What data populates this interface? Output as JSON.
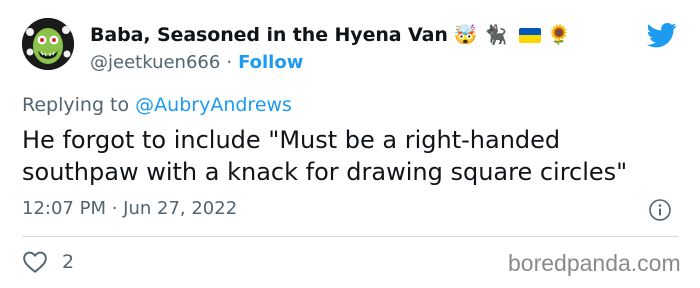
{
  "author": {
    "display_name": "Baba, Seasoned in the Hyena Van",
    "name_emojis": [
      "🤯",
      "🐈‍⬛",
      "🌻"
    ],
    "flag": "ukraine-flag",
    "handle": "@jeetkuen666",
    "separator": "·",
    "follow_label": "Follow"
  },
  "tweet": {
    "reply_prefix": "Replying to",
    "reply_target": "@AubryAndrews",
    "text": "He forgot to include \"Must be a right-handed southpaw with a knack for drawing square circles\"",
    "timestamp": "12:07 PM · Jun 27, 2022"
  },
  "engagement": {
    "like_count": "2"
  },
  "icons": {
    "brand": "twitter-bird-icon",
    "info": "info-icon",
    "like": "heart-icon"
  },
  "colors": {
    "accent": "#1d9bf0",
    "muted": "#536471",
    "text": "#0f1419",
    "divider": "#cfd9de"
  },
  "watermark": "boredpanda.com"
}
